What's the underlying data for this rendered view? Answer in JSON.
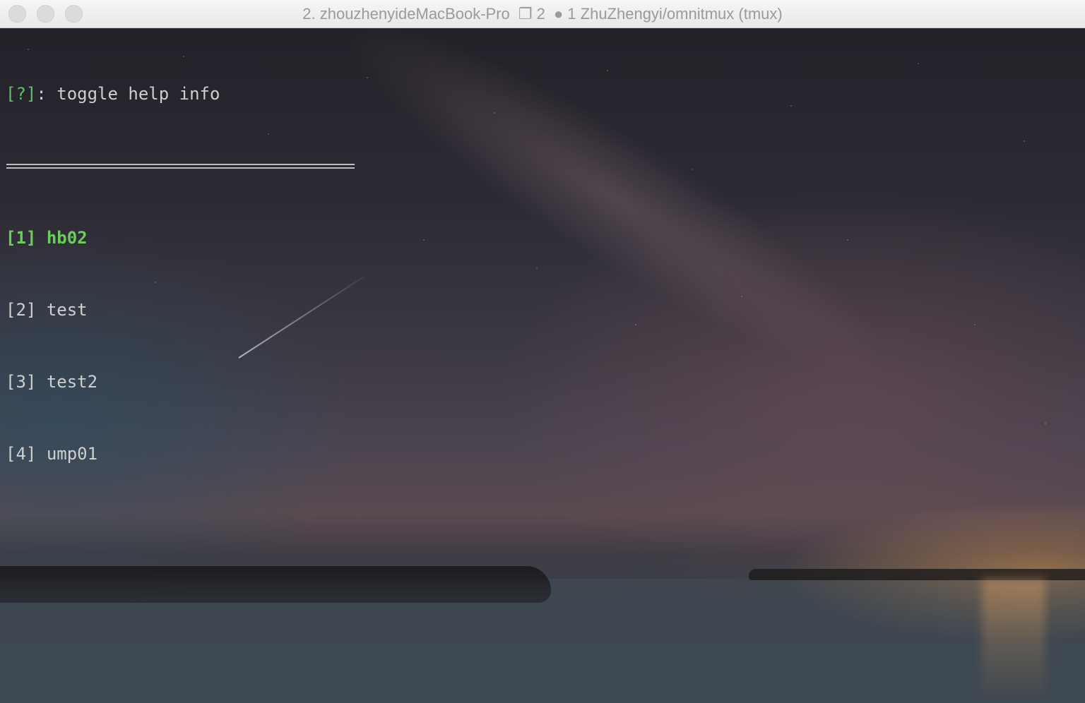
{
  "window": {
    "title_prefix": "2. zhouzhenyideMacBook-Pro",
    "tab_glyph": "❐",
    "tab_count": "2",
    "pane_glyph": "●",
    "pane_title": "1 ZhuZhengyi/omnitmux (tmux)"
  },
  "help": {
    "key": "[?]",
    "text": ": toggle help info"
  },
  "separator": "===============================================",
  "sessions": [
    {
      "index": "[1]",
      "name": "hb02"
    },
    {
      "index": "[2]",
      "name": "test"
    },
    {
      "index": "[3]",
      "name": "test2"
    },
    {
      "index": "[4]",
      "name": "ump01"
    }
  ],
  "colors": {
    "selected": "#6ccd5c",
    "help_key": "#5fbf6a",
    "text": "#cfcfcf"
  },
  "icons": {
    "close": "close-icon",
    "minimize": "minimize-icon",
    "maximize": "maximize-icon",
    "tab": "tab-icon",
    "pane": "pane-dot-icon"
  }
}
